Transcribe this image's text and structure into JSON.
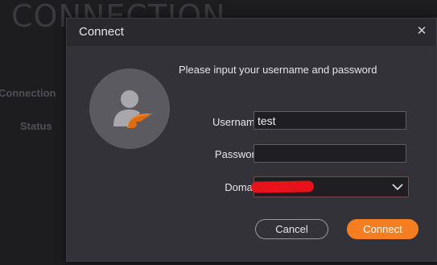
{
  "background": {
    "title": "CONNECTION",
    "labels": [
      "Connection",
      "Status"
    ]
  },
  "dialog": {
    "title": "Connect",
    "close_icon": "close-icon",
    "avatar_icon": "user-avatar-icon",
    "prompt": "Please input your username and password",
    "fields": {
      "username": {
        "label": "Username",
        "value": "test"
      },
      "password": {
        "label": "Password",
        "value": ""
      },
      "domain": {
        "label": "Domain",
        "value_redacted": true
      }
    },
    "buttons": {
      "cancel": "Cancel",
      "connect": "Connect"
    }
  },
  "colors": {
    "accent": "#f57f20",
    "dialog_bg": "#333238",
    "page_bg": "#1d1d20",
    "redaction": "#e8121b"
  }
}
